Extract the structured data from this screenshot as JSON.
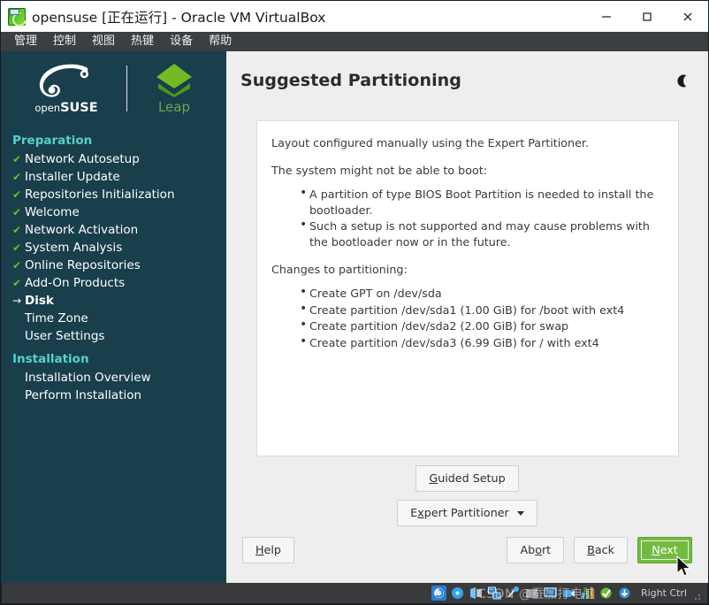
{
  "window": {
    "title": "opensuse [正在运行] - Oracle VM VirtualBox",
    "app_icon": "virtualbox-opensuse-icon",
    "controls": {
      "minimize": "minimize-icon",
      "maximize": "maximize-icon",
      "close": "close-icon"
    }
  },
  "menubar": {
    "items": [
      {
        "label": "管理"
      },
      {
        "label": "控制"
      },
      {
        "label": "视图"
      },
      {
        "label": "热键"
      },
      {
        "label": "设备"
      },
      {
        "label": "帮助"
      }
    ]
  },
  "sidebar": {
    "brand": {
      "suse_prefix": "open",
      "suse_name": "SUSE",
      "suse_reg": ".",
      "product": "Leap"
    },
    "groups": [
      {
        "title": "Preparation",
        "items": [
          {
            "label": "Network Autosetup",
            "state": "done"
          },
          {
            "label": "Installer Update",
            "state": "done"
          },
          {
            "label": "Repositories Initialization",
            "state": "done"
          },
          {
            "label": "Welcome",
            "state": "done"
          },
          {
            "label": "Network Activation",
            "state": "done"
          },
          {
            "label": "System Analysis",
            "state": "done"
          },
          {
            "label": "Online Repositories",
            "state": "done"
          },
          {
            "label": "Add-On Products",
            "state": "done"
          },
          {
            "label": "Disk",
            "state": "current"
          },
          {
            "label": "Time Zone",
            "state": "pending"
          },
          {
            "label": "User Settings",
            "state": "pending"
          }
        ]
      },
      {
        "title": "Installation",
        "items": [
          {
            "label": "Installation Overview",
            "state": "pending"
          },
          {
            "label": "Perform Installation",
            "state": "pending"
          }
        ]
      }
    ],
    "marks": {
      "done": "✔",
      "current": "→",
      "pending": " "
    },
    "colors": {
      "background": "#193e4c",
      "group_title": "#55d4c6",
      "check": "#73ba25"
    }
  },
  "main": {
    "title": "Suggested Partitioning",
    "dark_mode_icon": "moon-icon",
    "info": {
      "intro": "Layout configured manually using the Expert Partitioner.",
      "warning_heading": "The system might not be able to boot:",
      "warnings": [
        "A partition of type BIOS Boot Partition is needed to install the bootloader.",
        "Such a setup is not supported and may cause problems with the bootloader now or in the future."
      ],
      "changes_heading": "Changes to partitioning:",
      "changes": [
        "Create GPT on /dev/sda",
        "Create partition /dev/sda1 (1.00 GiB) for /boot with ext4",
        "Create partition /dev/sda2 (2.00 GiB) for swap",
        "Create partition /dev/sda3 (6.99 GiB) for / with ext4"
      ]
    },
    "actions": {
      "guided_setup": {
        "pre": "",
        "accel": "G",
        "post": "uided Setup"
      },
      "expert_partitioner": {
        "pre": "E",
        "accel": "x",
        "post": "pert Partitioner",
        "caret": "chevron-down-icon"
      }
    },
    "footer": {
      "help": {
        "accel": "H",
        "post": "elp"
      },
      "abort": {
        "pre": "Ab",
        "accel": "o",
        "post": "rt"
      },
      "back": {
        "pre": "",
        "accel": "B",
        "post": "ack"
      },
      "next": {
        "pre": "",
        "accel": "N",
        "post": "ext"
      },
      "next_color": "#73ba40"
    }
  },
  "statusbar": {
    "icons": [
      "hard-disk-icon",
      "optical-disk-icon",
      "floppy-disk-icon",
      "network-icon",
      "usb-icon",
      "shared-folder-icon",
      "display-icon",
      "video-capture-icon",
      "performance-icon",
      "features-icon",
      "mouse-integration-icon"
    ],
    "host_key": "Right Ctrl",
    "grip": "resize-grip-icon"
  },
  "overlay": {
    "watermark": "CSDN @蚕加打电脑"
  }
}
